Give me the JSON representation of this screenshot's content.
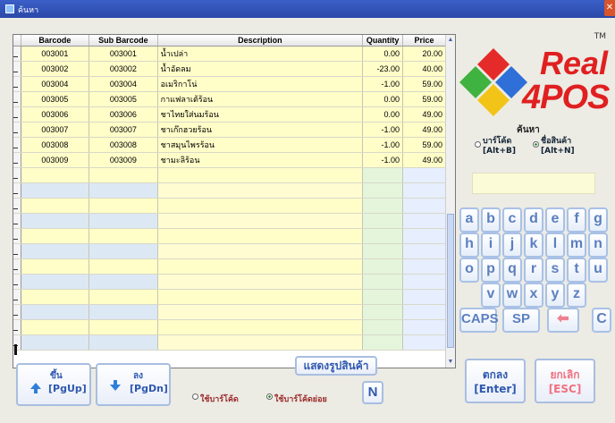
{
  "window": {
    "title": "ค้นหา",
    "close": "✕"
  },
  "grid": {
    "columns": [
      "Barcode",
      "Sub Barcode",
      "Description",
      "Quantity",
      "Price"
    ],
    "rows": [
      {
        "barcode": "003001",
        "sub": "003001",
        "desc": "น้ำเปล่า",
        "qty": "0.00",
        "price": "20.00"
      },
      {
        "barcode": "003002",
        "sub": "003002",
        "desc": "น้ำอัดลม",
        "qty": "-23.00",
        "price": "40.00"
      },
      {
        "barcode": "003004",
        "sub": "003004",
        "desc": "อเมริกาโน่",
        "qty": "-1.00",
        "price": "59.00"
      },
      {
        "barcode": "003005",
        "sub": "003005",
        "desc": "กาแฟลาเต้ร้อน",
        "qty": "0.00",
        "price": "59.00"
      },
      {
        "barcode": "003006",
        "sub": "003006",
        "desc": "ชาไทยใส่นมร้อน",
        "qty": "0.00",
        "price": "49.00"
      },
      {
        "barcode": "003007",
        "sub": "003007",
        "desc": "ชาเก๊กฮวยร้อน",
        "qty": "-1.00",
        "price": "49.00"
      },
      {
        "barcode": "003008",
        "sub": "003008",
        "desc": "ชาสมุนไพรร้อน",
        "qty": "-1.00",
        "price": "59.00"
      },
      {
        "barcode": "003009",
        "sub": "003009",
        "desc": "ชามะลิร้อน",
        "qty": "-1.00",
        "price": "49.00"
      }
    ]
  },
  "logo": {
    "line1": "Real",
    "line2": "4POS",
    "tm": "TM"
  },
  "search": {
    "label": "ค้นหา",
    "barcode_option": "บาร์โค้ด",
    "barcode_hotkey": "[Alt+B]",
    "name_option": "ชื่อสินค้า",
    "name_hotkey": "[Alt+N]",
    "selected": "name"
  },
  "keyboard": {
    "rows": [
      [
        "a",
        "b",
        "c",
        "d",
        "e",
        "f",
        "g"
      ],
      [
        "h",
        "i",
        "j",
        "k",
        "l",
        "m",
        "n"
      ],
      [
        "o",
        "p",
        "q",
        "r",
        "s",
        "t",
        "u"
      ],
      [
        "v",
        "w",
        "x",
        "y",
        "z"
      ]
    ],
    "caps": "CAPS",
    "space": "SP",
    "back": "⬅",
    "clear": "C"
  },
  "buttons": {
    "up_label": "ขึ้น",
    "up_key": "[PgUp]",
    "down_label": "ลง",
    "down_key": "[PgDn]",
    "show_image": "แสดงรูปสินค้า",
    "n_key": "N",
    "use_barcode": "ใช้บาร์โค้ด",
    "use_sub_barcode": "ใช้บาร์โค้ดย่อย",
    "selected_barcode_mode": "sub",
    "ok_label": "ตกลง",
    "ok_key": "[Enter]",
    "cancel_label": "ยกเลิก",
    "cancel_key": "[ESC]"
  },
  "colors": {
    "accent": "#2f58b0",
    "brand_red": "#e02020",
    "cancel_pink": "#f07080",
    "row_yellow": "#fffdc8"
  }
}
